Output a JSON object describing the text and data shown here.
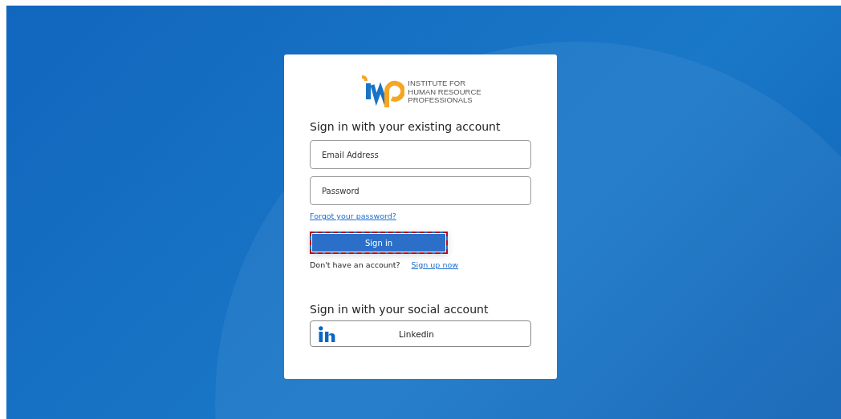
{
  "logo": {
    "text": [
      "INSTITUTE FOR",
      "HUMAN RESOURCE",
      "PROFESSIONALS"
    ]
  },
  "heading": "Sign in with your existing account",
  "fields": [
    {
      "placeholder": "Email Address"
    },
    {
      "placeholder": "Password"
    }
  ],
  "forgot_link": "Forgot your password?",
  "sign_in_button": {
    "label": "Sign in",
    "highlighted": true
  },
  "signup": {
    "prompt": "Don't have an account?",
    "link": "Sign up now"
  },
  "social_heading": "Sign in with your social account",
  "social_buttons": [
    {
      "label": "Linkedin"
    }
  ]
}
